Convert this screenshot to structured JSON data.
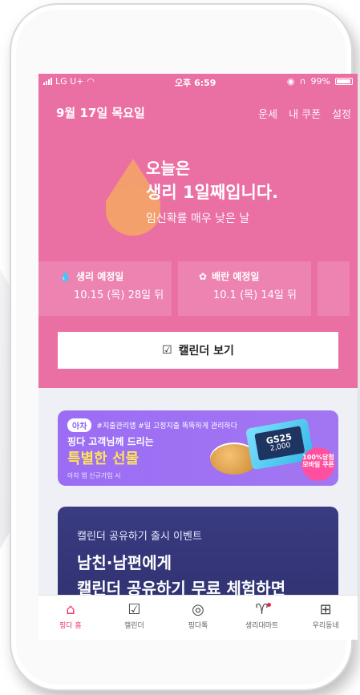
{
  "status": {
    "carrier": "LG U+",
    "time": "오후 6:59",
    "battery": "99%"
  },
  "header": {
    "date": "9월 17일 목요일",
    "links": [
      "운세",
      "내 쿠폰",
      "설정"
    ]
  },
  "today": {
    "line1": "오늘은",
    "line2": "생리 1일째입니다.",
    "sub": "임신확률 매우 낮은 날"
  },
  "cards": [
    {
      "title": "생리 예정일",
      "value": "10.15 (목) 28일 뒤",
      "icon": "drop-icon"
    },
    {
      "title": "배란 예정일",
      "value": "10.1 (목) 14일 뒤",
      "icon": "flower-icon"
    }
  ],
  "calendar_button": "캘린더 보기",
  "promo": {
    "pill": "아차",
    "tagline": "#지출관리앱 #일 고정지출 똑똑하게 관리하다",
    "line1": "핑다 고객님께 드리는",
    "line2": "특별한 선물",
    "line3": "아차 앱 신규가입 시",
    "ticket_brand": "GS25",
    "ticket_amount": "2,000",
    "badge": "100%당첨 모바일 쿠폰"
  },
  "event": {
    "caption": "캘린더 공유하기 출시 이벤트",
    "headline1": "남친·남편에게",
    "headline2": "캘린더 공유하기 무료 체험하면"
  },
  "tabs": [
    {
      "label": "핑다 홈",
      "icon": "home-icon",
      "active": true
    },
    {
      "label": "캘린더",
      "icon": "calendar-check-icon",
      "active": false
    },
    {
      "label": "핑다톡",
      "icon": "lips-icon",
      "active": false
    },
    {
      "label": "생리대마트",
      "icon": "store-icon",
      "active": false
    },
    {
      "label": "우리동네",
      "icon": "map-pin-icon",
      "active": false
    }
  ],
  "colors": {
    "pink": "#ea6fa3",
    "drop": "#f3a06c",
    "promo": "#9b6df4",
    "event": "#2f3170",
    "active_tab": "#ef3a6a"
  }
}
